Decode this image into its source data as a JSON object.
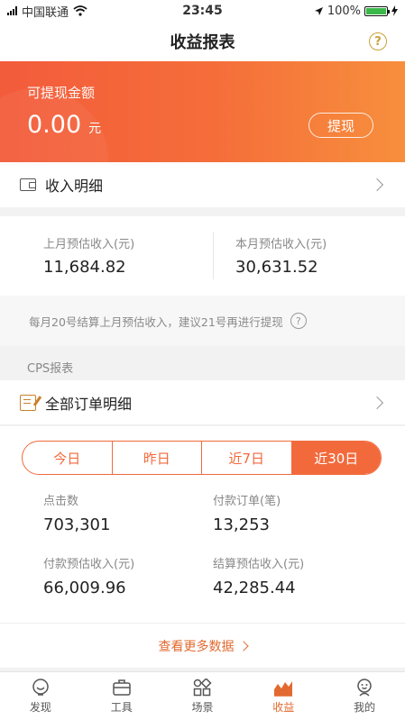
{
  "status_bar": {
    "carrier": "中国联通",
    "time": "23:45",
    "battery": "100%",
    "battery_level": 1.0
  },
  "nav": {
    "title": "收益报表"
  },
  "banner": {
    "label": "可提现金额",
    "amount": "0.00",
    "unit": "元",
    "withdraw_label": "提现"
  },
  "income_detail": {
    "label": "收入明细"
  },
  "summary": [
    {
      "label": "上月预估收入(元)",
      "value": "11,684.82"
    },
    {
      "label": "本月预估收入(元)",
      "value": "30,631.52"
    }
  ],
  "notice": {
    "text": "每月20号结算上月预估收入，建议21号再进行提现"
  },
  "cps": {
    "section_label": "CPS报表",
    "orders_label": "全部订单明细"
  },
  "periods": [
    {
      "label": "今日",
      "active": false
    },
    {
      "label": "昨日",
      "active": false
    },
    {
      "label": "近7日",
      "active": false
    },
    {
      "label": "近30日",
      "active": true
    }
  ],
  "metrics": [
    {
      "label": "点击数",
      "value": "703,301"
    },
    {
      "label": "付款订单(笔)",
      "value": "13,253"
    },
    {
      "label": "付款预估收入(元)",
      "value": "66,009.96"
    },
    {
      "label": "结算预估收入(元)",
      "value": "42,285.44"
    }
  ],
  "more_link": {
    "label": "查看更多数据"
  },
  "tabs": [
    {
      "label": "发现",
      "icon": "discover-icon",
      "active": false
    },
    {
      "label": "工具",
      "icon": "toolbox-icon",
      "active": false
    },
    {
      "label": "场景",
      "icon": "scenes-icon",
      "active": false
    },
    {
      "label": "收益",
      "icon": "earnings-chart-icon",
      "active": true
    },
    {
      "label": "我的",
      "icon": "profile-icon",
      "active": false
    }
  ],
  "colors": {
    "accent": "#f26a3c",
    "link": "#e2692f",
    "help": "#c9a23a"
  }
}
